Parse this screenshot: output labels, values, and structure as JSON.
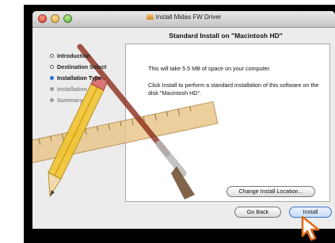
{
  "window": {
    "title": "Install Midas FW Driver"
  },
  "pane": {
    "title": "Standard Install on \"Macintosh HD\""
  },
  "steps": [
    {
      "label": "Introduction",
      "state": "done"
    },
    {
      "label": "Destination Select",
      "state": "done"
    },
    {
      "label": "Installation Type",
      "state": "current"
    },
    {
      "label": "Installation",
      "state": "pending"
    },
    {
      "label": "Summary",
      "state": "pending"
    }
  ],
  "content": {
    "line1": "This will take 5.5 MB of space on your computer.",
    "line2": "Click Install to perform a standard installation of this software on the disk \"Macintosh HD\"."
  },
  "buttons": {
    "change_location": "Change Install Location...",
    "go_back": "Go Back",
    "install": "Install"
  },
  "colors": {
    "current_step": "#2a6ed8",
    "install_accent": "#3a73c8"
  }
}
